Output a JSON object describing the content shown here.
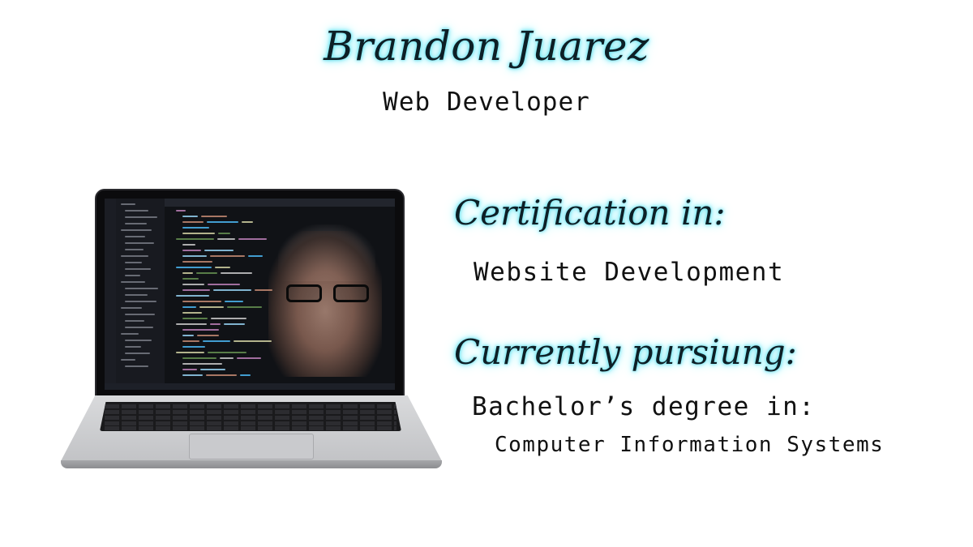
{
  "header": {
    "name": "Brandon Juarez",
    "role": "Web Developer"
  },
  "certification": {
    "heading": "Certification in:",
    "value": "Website Development"
  },
  "pursuing": {
    "heading": "Currently pursiung:",
    "degree": "Bachelor’s degree in:",
    "major": "Computer Information Systems"
  },
  "colors": {
    "glow": "#6fe3f0",
    "text": "#111111"
  },
  "image": {
    "icon": "laptop-with-code-editor-portrait"
  }
}
